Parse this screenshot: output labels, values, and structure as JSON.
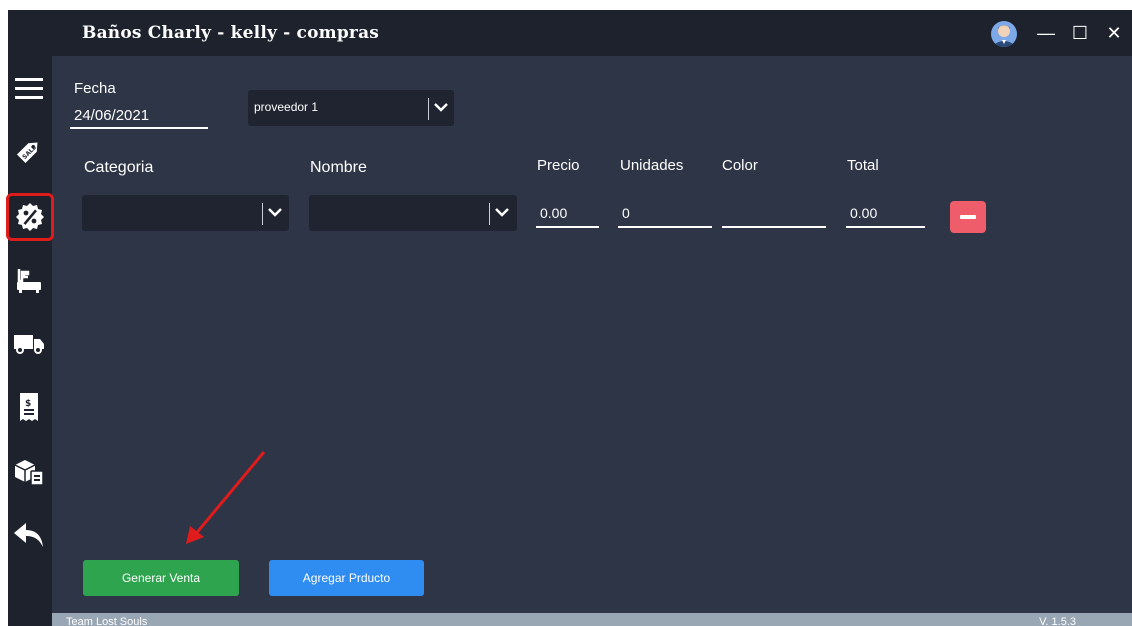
{
  "window": {
    "title": "Baños Charly - kelly - compras",
    "minimize": "—",
    "maximize": "☐",
    "close": "✕"
  },
  "sidebar": {
    "items": [
      {
        "icon": "menu-icon"
      },
      {
        "icon": "sale-tag-icon"
      },
      {
        "icon": "discount-badge-icon",
        "active": true
      },
      {
        "icon": "bathtub-icon"
      },
      {
        "icon": "truck-icon"
      },
      {
        "icon": "receipt-icon"
      },
      {
        "icon": "boxes-icon"
      },
      {
        "icon": "back-arrow-icon"
      }
    ]
  },
  "header": {
    "fecha_label": "Fecha",
    "fecha_value": "24/06/2021",
    "proveedor_value": "proveedor 1"
  },
  "columns": {
    "categoria": "Categoria",
    "nombre": "Nombre",
    "precio": "Precio",
    "unidades": "Unidades",
    "color": "Color",
    "total": "Total"
  },
  "row": {
    "categoria": "",
    "nombre": "",
    "precio": "0.00",
    "unidades": "0",
    "color": "",
    "total": "0.00"
  },
  "actions": {
    "generar": "Generar Venta",
    "agregar": "Agregar Prducto"
  },
  "footer": {
    "team": "Team Lost Souls",
    "version": "V. 1.5.3"
  },
  "colors": {
    "background": "#2e3546",
    "sidebar": "#1d222d",
    "generar_button": "#2ea44f",
    "agregar_button": "#2f8cf0",
    "remove_button": "#ef5c6a",
    "annotation_arrow": "#e01b1b"
  }
}
